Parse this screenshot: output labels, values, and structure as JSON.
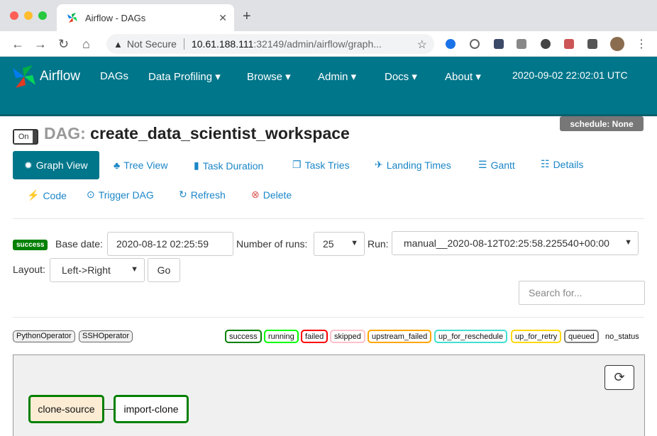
{
  "browser": {
    "tab_title": "Airflow - DAGs",
    "tab_close": "✕",
    "new_tab": "+",
    "not_secure": "Not Secure",
    "url_host": "10.61.188.111",
    "url_path": ":32149/admin/airflow/graph..."
  },
  "navbar": {
    "brand": "Airflow",
    "items": [
      "DAGs",
      "Data Profiling ▾",
      "Browse ▾",
      "Admin ▾",
      "Docs ▾",
      "About ▾"
    ],
    "datetime": "2020-09-02 22:02:01 UTC"
  },
  "dag": {
    "toggle": "On",
    "label": "DAG:",
    "name": "create_data_scientist_workspace",
    "schedule": "schedule: None"
  },
  "views": {
    "graph": "Graph View",
    "tree": "Tree View",
    "duration": "Task Duration",
    "tries": "Task Tries",
    "landing": "Landing Times",
    "gantt": "Gantt",
    "details": "Details",
    "code": "Code",
    "trigger": "Trigger DAG",
    "refresh": "Refresh",
    "delete": "Delete"
  },
  "form": {
    "state_badge": "success",
    "base_date_label": "Base date:",
    "base_date_value": "2020-08-12 02:25:59",
    "num_runs_label": "Number of runs:",
    "num_runs_value": "25",
    "run_label": "Run:",
    "run_value": "manual__2020-08-12T02:25:58.225540+00:00",
    "layout_label": "Layout:",
    "layout_value": "Left->Right",
    "go": "Go",
    "search_placeholder": "Search for..."
  },
  "operators": [
    "PythonOperator",
    "SSHOperator"
  ],
  "statuses": [
    {
      "label": "success",
      "color": "#008000"
    },
    {
      "label": "running",
      "color": "#00ff00"
    },
    {
      "label": "failed",
      "color": "#ff0000"
    },
    {
      "label": "skipped",
      "color": "#ffc0cb"
    },
    {
      "label": "upstream_failed",
      "color": "#ffa500"
    },
    {
      "label": "up_for_reschedule",
      "color": "#40e0d0"
    },
    {
      "label": "up_for_retry",
      "color": "#ffd700"
    },
    {
      "label": "queued",
      "color": "#808080"
    },
    {
      "label": "no_status",
      "color": "#ffffff"
    }
  ],
  "graph": {
    "nodes": [
      "clone-source",
      "import-clone"
    ]
  },
  "colors": {
    "navbar": "#00768a",
    "link": "#1a86c8",
    "success": "#008000"
  }
}
